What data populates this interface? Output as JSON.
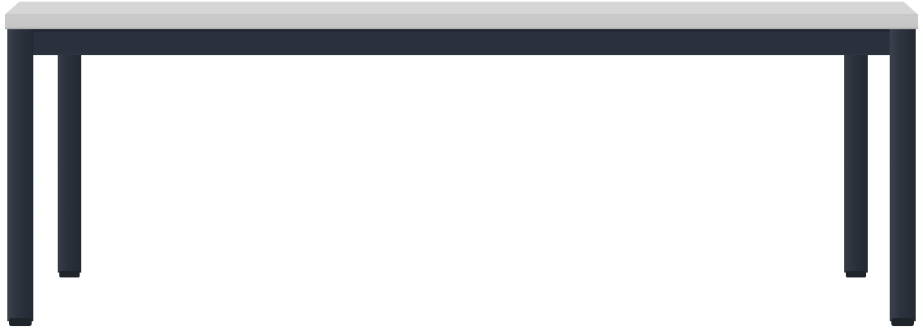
{
  "object": {
    "kind": "table",
    "colors": {
      "background": "#ffffff",
      "tabletop": "#c9c9c9",
      "tabletop_edge": "#b5b5b5",
      "frame": "#2e3440",
      "frame_shadow": "#20242c",
      "frame_highlight": "#4a505c",
      "foot": "#1f232a"
    }
  }
}
